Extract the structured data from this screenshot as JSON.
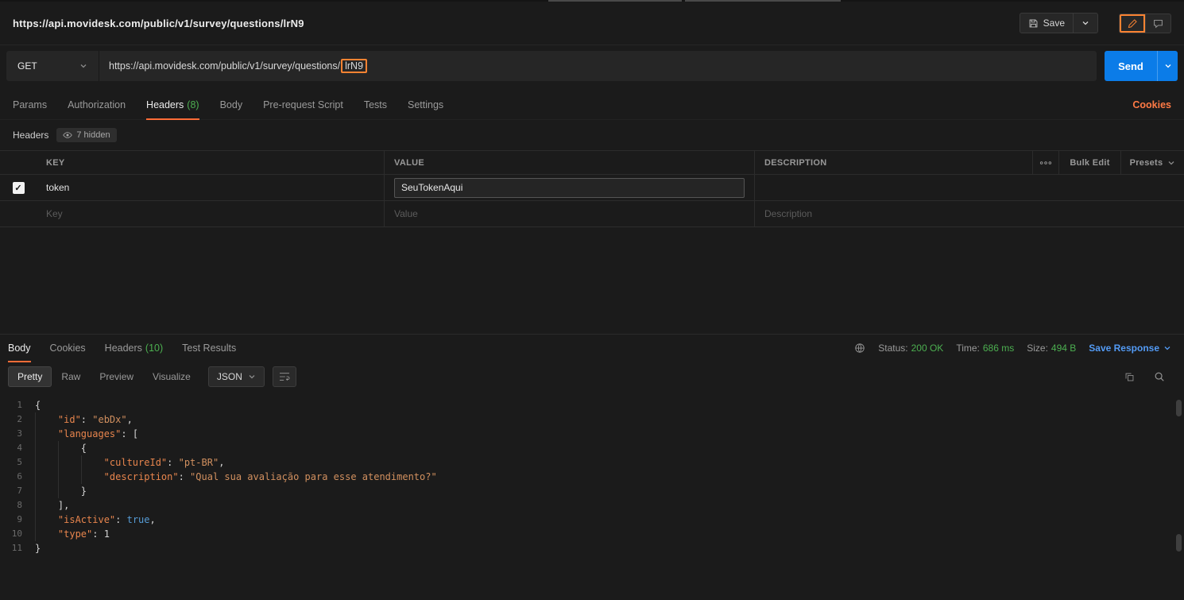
{
  "colors": {
    "accent_orange": "#ff6c37",
    "annotation_orange": "#fb8332",
    "send_blue": "#0b7ce8",
    "status_green": "#4caf50",
    "link_blue": "#539bf5"
  },
  "icons": {
    "save": "floppy",
    "edit": "pencil",
    "comment": "comment-bubble",
    "carets": "chevron-down",
    "hidden": "eye",
    "more": "three-dots",
    "network": "globe",
    "wrap": "text-wrap",
    "copy": "copy",
    "search": "magnifier"
  },
  "topbar": {
    "title": "https://api.movidesk.com/public/v1/survey/questions/lrN9",
    "save_label": "Save"
  },
  "request": {
    "method": "GET",
    "url_prefix": "https://api.movidesk.com/public/v1/survey/questions/",
    "url_highlight": "lrN9",
    "send_label": "Send",
    "tabs": [
      {
        "label": "Params"
      },
      {
        "label": "Authorization"
      },
      {
        "label": "Headers",
        "count": "(8)"
      },
      {
        "label": "Body"
      },
      {
        "label": "Pre-request Script"
      },
      {
        "label": "Tests"
      },
      {
        "label": "Settings"
      }
    ],
    "cookies_link": "Cookies"
  },
  "headers_editor": {
    "title": "Headers",
    "hidden_badge": "7 hidden",
    "columns": {
      "key": "KEY",
      "value": "VALUE",
      "description": "DESCRIPTION"
    },
    "bulk_edit": "Bulk Edit",
    "presets": "Presets",
    "rows": [
      {
        "key": "token",
        "value": "SeuTokenAqui",
        "description": ""
      }
    ],
    "placeholders": {
      "key": "Key",
      "value": "Value",
      "description": "Description"
    }
  },
  "response": {
    "tabs": [
      {
        "label": "Body"
      },
      {
        "label": "Cookies"
      },
      {
        "label": "Headers",
        "count": "(10)"
      },
      {
        "label": "Test Results"
      }
    ],
    "status_label": "Status:",
    "status_value": "200 OK",
    "time_label": "Time:",
    "time_value": "686 ms",
    "size_label": "Size:",
    "size_value": "494 B",
    "save_response": "Save Response",
    "view_tabs": [
      "Pretty",
      "Raw",
      "Preview",
      "Visualize"
    ],
    "format": "JSON",
    "code": {
      "lines": [
        {
          "n": 1,
          "toks": [
            [
              "p",
              "{"
            ]
          ]
        },
        {
          "n": 2,
          "toks": [
            [
              "w",
              "    "
            ],
            [
              "k",
              "\"id\""
            ],
            [
              "p",
              ": "
            ],
            [
              "s",
              "\"ebDx\""
            ],
            [
              "p",
              ","
            ]
          ]
        },
        {
          "n": 3,
          "toks": [
            [
              "w",
              "    "
            ],
            [
              "k",
              "\"languages\""
            ],
            [
              "p",
              ": ["
            ]
          ]
        },
        {
          "n": 4,
          "toks": [
            [
              "w",
              "        "
            ],
            [
              "p",
              "{"
            ]
          ]
        },
        {
          "n": 5,
          "toks": [
            [
              "w",
              "            "
            ],
            [
              "k",
              "\"cultureId\""
            ],
            [
              "p",
              ": "
            ],
            [
              "s",
              "\"pt-BR\""
            ],
            [
              "p",
              ","
            ]
          ]
        },
        {
          "n": 6,
          "toks": [
            [
              "w",
              "            "
            ],
            [
              "k",
              "\"description\""
            ],
            [
              "p",
              ": "
            ],
            [
              "s",
              "\"Qual sua avaliação para esse atendimento?\""
            ]
          ]
        },
        {
          "n": 7,
          "toks": [
            [
              "w",
              "        "
            ],
            [
              "p",
              "}"
            ]
          ]
        },
        {
          "n": 8,
          "toks": [
            [
              "w",
              "    "
            ],
            [
              "p",
              "],"
            ]
          ]
        },
        {
          "n": 9,
          "toks": [
            [
              "w",
              "    "
            ],
            [
              "k",
              "\"isActive\""
            ],
            [
              "p",
              ": "
            ],
            [
              "b",
              "true"
            ],
            [
              "p",
              ","
            ]
          ]
        },
        {
          "n": 10,
          "toks": [
            [
              "w",
              "    "
            ],
            [
              "k",
              "\"type\""
            ],
            [
              "p",
              ": "
            ],
            [
              "n",
              "1"
            ]
          ]
        },
        {
          "n": 11,
          "toks": [
            [
              "p",
              "}"
            ]
          ]
        }
      ]
    }
  }
}
